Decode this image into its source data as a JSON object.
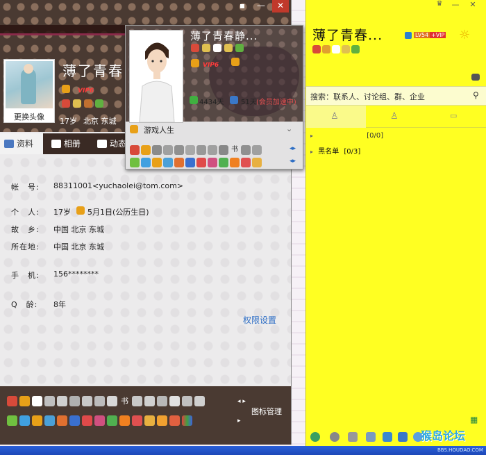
{
  "profile": {
    "window_controls": [
      "▪",
      "—",
      "✕"
    ],
    "nickname": "薄了青春",
    "vip_label": "VIP6",
    "change_avatar": "更换头像",
    "age": "17岁",
    "location": "北京 东城",
    "tabs": [
      "资料",
      "相册",
      "动态"
    ],
    "fields": {
      "account_label": "帐　号:",
      "account_value": "88311001<yuchaolei@tom.com>",
      "personal_label": "个　人:",
      "personal_age": "17岁",
      "personal_birthday": "5月1日(公历生日)",
      "hometown_label": "故　乡:",
      "hometown_value": "中国 北京 东城",
      "residence_label": "所在地:",
      "residence_value": "中国 北京 东城",
      "phone_label": "手　机:",
      "phone_value": "156********",
      "qage_label": "Q　龄:",
      "qage_value": "8年"
    },
    "permission_link": "权限设置",
    "icon_manage": "图标管理",
    "icon_glyph_shu": "书"
  },
  "card": {
    "nickname": "薄了青春静...",
    "vip_label": "VIP6",
    "days_total": "4434天",
    "days_speed": "51天",
    "days_note": "(会员加速中)",
    "status": "游戏人生"
  },
  "qq": {
    "nickname": "薄了青春...",
    "level_badge": "LV54",
    "vip_badge": "+VIP",
    "search_placeholder": "搜索：联系人、讨论组、群、企业",
    "group_count": "[0/0]",
    "blacklist_label": "黑名单",
    "blacklist_count": "[0/3]"
  },
  "watermark": {
    "text": "猴岛论坛",
    "url": "BBS.HOUDAO.COM"
  },
  "colors": {
    "qq_bg": "#ffff22",
    "link": "#2b6cc4",
    "vip_red": "#ff3c3c"
  }
}
